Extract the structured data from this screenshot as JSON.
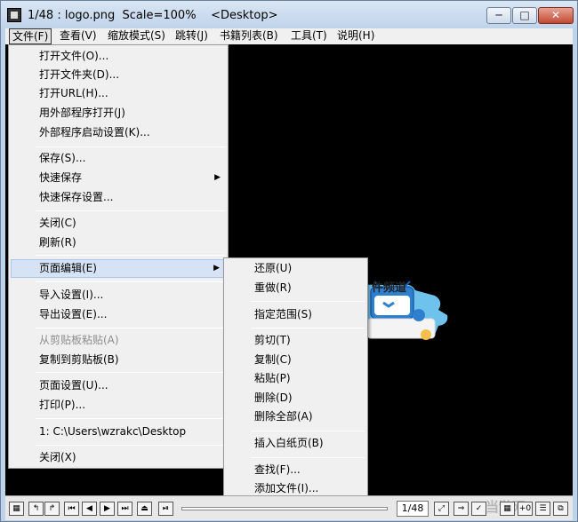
{
  "window": {
    "title": "1/48 : logo.png  Scale=100%    <Desktop>",
    "buttons": {
      "minimize": "─",
      "maximize": "□",
      "close": "✕"
    }
  },
  "menubar": {
    "items": [
      "文件(F)",
      "查看(V)",
      "缩放模式(S)",
      "跳转(J)",
      "书籍列表(B)",
      "工具(T)",
      "说明(H)"
    ]
  },
  "file_menu": {
    "items": [
      "打开文件(O)...",
      "打开文件夹(D)...",
      "打开URL(H)...",
      "用外部程序打开(J)",
      "外部程序启动设置(K)...",
      "保存(S)...",
      "快速保存",
      "快速保存设置...",
      "关闭(C)",
      "刷新(R)",
      "页面编辑(E)",
      "导入设置(I)...",
      "导出设置(E)...",
      "从剪贴板粘贴(A)",
      "复制到剪贴板(B)",
      "页面设置(U)...",
      "打印(P)...",
      "1: C:\\Users\\wzrakc\\Desktop",
      "关闭(X)"
    ],
    "arrow": "▶"
  },
  "edit_submenu": {
    "items": [
      "还原(U)",
      "重做(R)",
      "指定范围(S)",
      "剪切(T)",
      "复制(C)",
      "粘贴(P)",
      "删除(D)",
      "删除全部(A)",
      "插入白纸页(B)",
      "查找(F)...",
      "添加文件(I)..."
    ]
  },
  "canvas_logo": {
    "text": "件频道"
  },
  "toolbar": {
    "page_counter": "1/48",
    "watermark": "当游网"
  },
  "colors": {
    "titlebar": "#bfd3ea",
    "menu_bg": "#f0f0f0",
    "highlight": "#d5e3f5",
    "canvas": "#000000"
  }
}
